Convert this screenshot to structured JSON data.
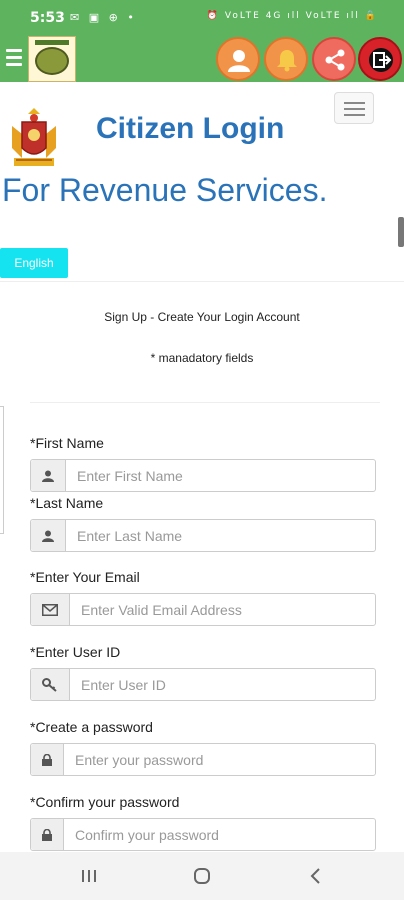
{
  "status_bar": {
    "time": "5:53",
    "left_icons": "✉ ▣ ⊕ •",
    "right_icons": "⏰ VoLTE 4G ıll VoLTE ıll 🔒"
  },
  "app_bar": {
    "menu_icon": "menu-icon",
    "logo": "app-logo",
    "actions": [
      {
        "name": "profile",
        "icon": "user-icon"
      },
      {
        "name": "notifications",
        "icon": "bell-icon"
      },
      {
        "name": "share",
        "icon": "share-icon"
      },
      {
        "name": "logout",
        "icon": "logout-icon"
      }
    ],
    "colors": {
      "bar": "#5db35e",
      "profile": "#f2934a",
      "share": "#ef6b5f",
      "logout": "#d8222a"
    }
  },
  "header": {
    "title": "Citizen Login",
    "subtitle": "For Revenue Services.",
    "language_button": "English",
    "title_color": "#2a73b8",
    "language_color": "#16e3f0"
  },
  "form": {
    "heading": "Sign Up - Create Your Login Account",
    "mandatory_note": "* manadatory fields",
    "fields": [
      {
        "label": "*First Name",
        "placeholder": "Enter First Name",
        "icon": "user-icon"
      },
      {
        "label": "*Last Name",
        "placeholder": "Enter Last Name",
        "icon": "user-icon"
      },
      {
        "label": "*Enter Your Email",
        "placeholder": "Enter Valid Email Address",
        "icon": "envelope-icon"
      },
      {
        "label": "*Enter User ID",
        "placeholder": "Enter User ID",
        "icon": "key-icon"
      },
      {
        "label": "*Create a password",
        "placeholder": "Enter your password",
        "icon": "lock-icon"
      },
      {
        "label": "*Confirm your password",
        "placeholder": "Confirm your password",
        "icon": "lock-icon"
      }
    ]
  },
  "nav_bar": {
    "buttons": [
      "recents-icon",
      "home-icon",
      "back-icon"
    ]
  }
}
